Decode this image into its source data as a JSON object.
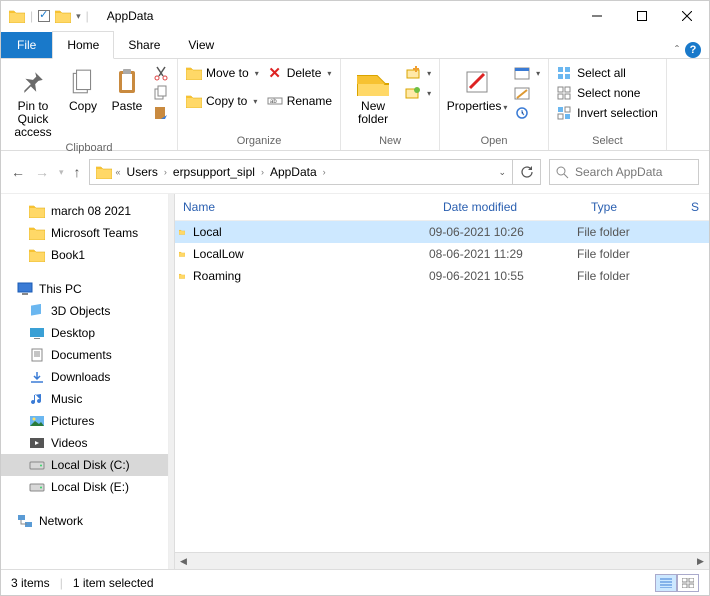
{
  "window": {
    "title": "AppData"
  },
  "qat": {
    "save_shown": false
  },
  "tabs": {
    "file": "File",
    "home": "Home",
    "share": "Share",
    "view": "View"
  },
  "ribbon": {
    "clipboard": {
      "label": "Clipboard",
      "pin": "Pin to Quick\naccess",
      "copy": "Copy",
      "paste": "Paste"
    },
    "organize": {
      "label": "Organize",
      "move_to": "Move to",
      "copy_to": "Copy to",
      "delete": "Delete",
      "rename": "Rename"
    },
    "new": {
      "label": "New",
      "new_folder": "New\nfolder"
    },
    "open": {
      "label": "Open",
      "properties": "Properties"
    },
    "select": {
      "label": "Select",
      "select_all": "Select all",
      "select_none": "Select none",
      "invert": "Invert selection"
    }
  },
  "breadcrumb": {
    "items": [
      "Users",
      "erpsupport_sipl",
      "AppData"
    ]
  },
  "search": {
    "placeholder": "Search AppData"
  },
  "tree": {
    "quick": [
      {
        "label": "march 08 2021"
      },
      {
        "label": "Microsoft Teams"
      },
      {
        "label": "Book1"
      }
    ],
    "this_pc": "This PC",
    "pc_items": [
      {
        "label": "3D Objects"
      },
      {
        "label": "Desktop"
      },
      {
        "label": "Documents"
      },
      {
        "label": "Downloads"
      },
      {
        "label": "Music"
      },
      {
        "label": "Pictures"
      },
      {
        "label": "Videos"
      },
      {
        "label": "Local Disk (C:)",
        "selected": true
      },
      {
        "label": "Local Disk (E:)"
      }
    ],
    "network": "Network"
  },
  "columns": {
    "name": "Name",
    "date": "Date modified",
    "type": "Type",
    "size": "S"
  },
  "rows": [
    {
      "name": "Local",
      "date": "09-06-2021 10:26",
      "type": "File folder",
      "selected": true
    },
    {
      "name": "LocalLow",
      "date": "08-06-2021 11:29",
      "type": "File folder",
      "selected": false
    },
    {
      "name": "Roaming",
      "date": "09-06-2021 10:55",
      "type": "File folder",
      "selected": false
    }
  ],
  "status": {
    "count": "3 items",
    "selection": "1 item selected"
  }
}
